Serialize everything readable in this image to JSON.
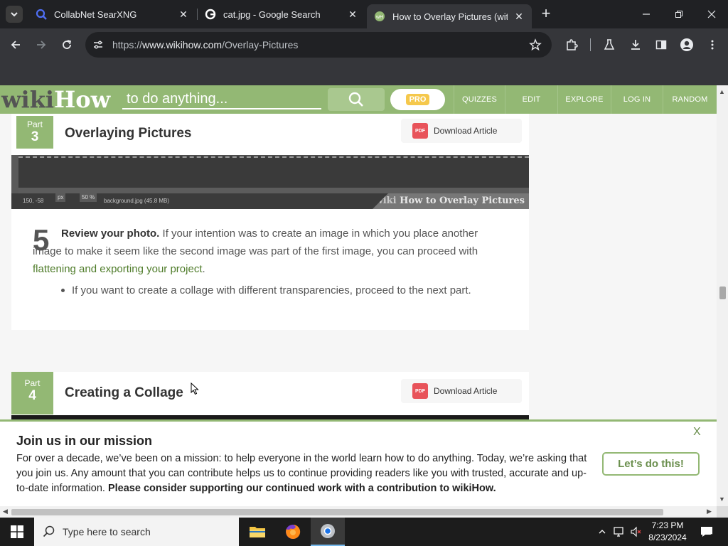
{
  "browser": {
    "tabs": [
      {
        "title": "CollabNet SearXNG",
        "active": false
      },
      {
        "title": "cat.jpg - Google Search",
        "active": false
      },
      {
        "title": "How to Overlay Pictures (with",
        "active": true
      }
    ],
    "url_prefix": "https://",
    "url_domain": "www.wikihow.com",
    "url_path": "/Overlay-Pictures"
  },
  "wikihow": {
    "logo_wiki": "wiki",
    "logo_how": "How",
    "search_placeholder": "to do anything...",
    "pro_label": "PRO",
    "nav": [
      "QUIZZES",
      "EDIT",
      "EXPLORE",
      "LOG IN",
      "RANDOM"
    ]
  },
  "part3": {
    "part_label": "Part",
    "part_number": "3",
    "title": "Overlaying Pictures",
    "download_label": "Download Article",
    "pdf_label": "PDF"
  },
  "image_strip": {
    "coords": "150, -58",
    "unit": "px",
    "zoom": "50 %",
    "filename": "background.jpg (45.8 MB)",
    "watermark_wiki": "wiki",
    "watermark_rest": "How to Overlay Pictures"
  },
  "step5": {
    "number": "5",
    "bold": "Review your photo.",
    "text": " If your intention was to create an image in which you place another image to make it seem like the second image was part of the first image, you can proceed with ",
    "link": "flattening and exporting your project",
    "end": ".",
    "bullet": "If you want to create a collage with different transparencies, proceed to the next part."
  },
  "part4": {
    "part_label": "Part",
    "part_number": "4",
    "title": "Creating a Collage",
    "download_label": "Download Article",
    "pdf_label": "PDF"
  },
  "banner": {
    "title": "Join us in our mission",
    "text": "For over a decade, we’ve been on a mission: to help everyone in the world learn how to do anything. Today, we’re asking that you join us. Any amount that you can contribute helps us to continue providing readers like you with trusted, accurate and up-to-date information. ",
    "bold": "Please consider supporting our continued work with a contribution to wikiHow.",
    "button": "Let’s do this!",
    "close": "X"
  },
  "taskbar": {
    "search_placeholder": "Type here to search",
    "time": "7:23 PM",
    "date": "8/23/2024"
  },
  "colors": {
    "wikihow_green": "#93b874",
    "chrome_dark": "#202124",
    "pdf_red": "#e8535a"
  }
}
